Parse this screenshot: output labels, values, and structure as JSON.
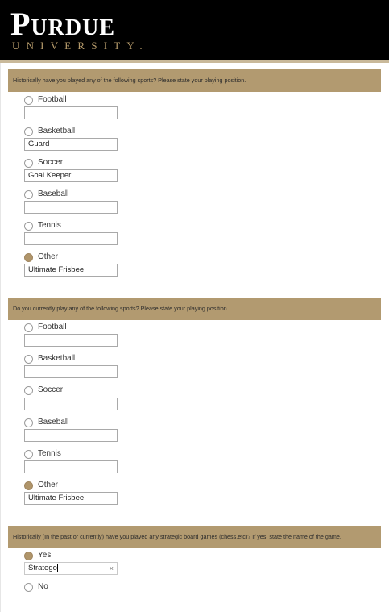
{
  "header": {
    "logo_main": "Purdue",
    "logo_sub": "UNIVERSITY."
  },
  "q1": {
    "text": "Historically have you played any of the following sports? Please state your playing position.",
    "options": [
      {
        "label": "Football",
        "checked": false,
        "value": ""
      },
      {
        "label": "Basketball",
        "checked": false,
        "value": "Guard"
      },
      {
        "label": "Soccer",
        "checked": false,
        "value": "Goal Keeper"
      },
      {
        "label": "Baseball",
        "checked": false,
        "value": ""
      },
      {
        "label": "Tennis",
        "checked": false,
        "value": ""
      },
      {
        "label": "Other",
        "checked": true,
        "value": "Ultimate Frisbee"
      }
    ]
  },
  "q2": {
    "text": "Do you currently play any of the following sports? Please state your playing position.",
    "options": [
      {
        "label": "Football",
        "checked": false,
        "value": ""
      },
      {
        "label": "Basketball",
        "checked": false,
        "value": ""
      },
      {
        "label": "Soccer",
        "checked": false,
        "value": ""
      },
      {
        "label": "Baseball",
        "checked": false,
        "value": ""
      },
      {
        "label": "Tennis",
        "checked": false,
        "value": ""
      },
      {
        "label": "Other",
        "checked": true,
        "value": "Ultimate Frisbee"
      }
    ]
  },
  "q3": {
    "text": "Historically (In the past or currently) have you played any strategic board games (chess,etc)? If yes, state the name of the game.",
    "yes_label": "Yes",
    "yes_checked": true,
    "yes_value": "Stratego",
    "clear_glyph": "×",
    "no_label": "No",
    "no_checked": false
  },
  "colors": {
    "header_bg": "#000000",
    "gold": "#b29a70",
    "radio_checked": "#b0956a"
  }
}
